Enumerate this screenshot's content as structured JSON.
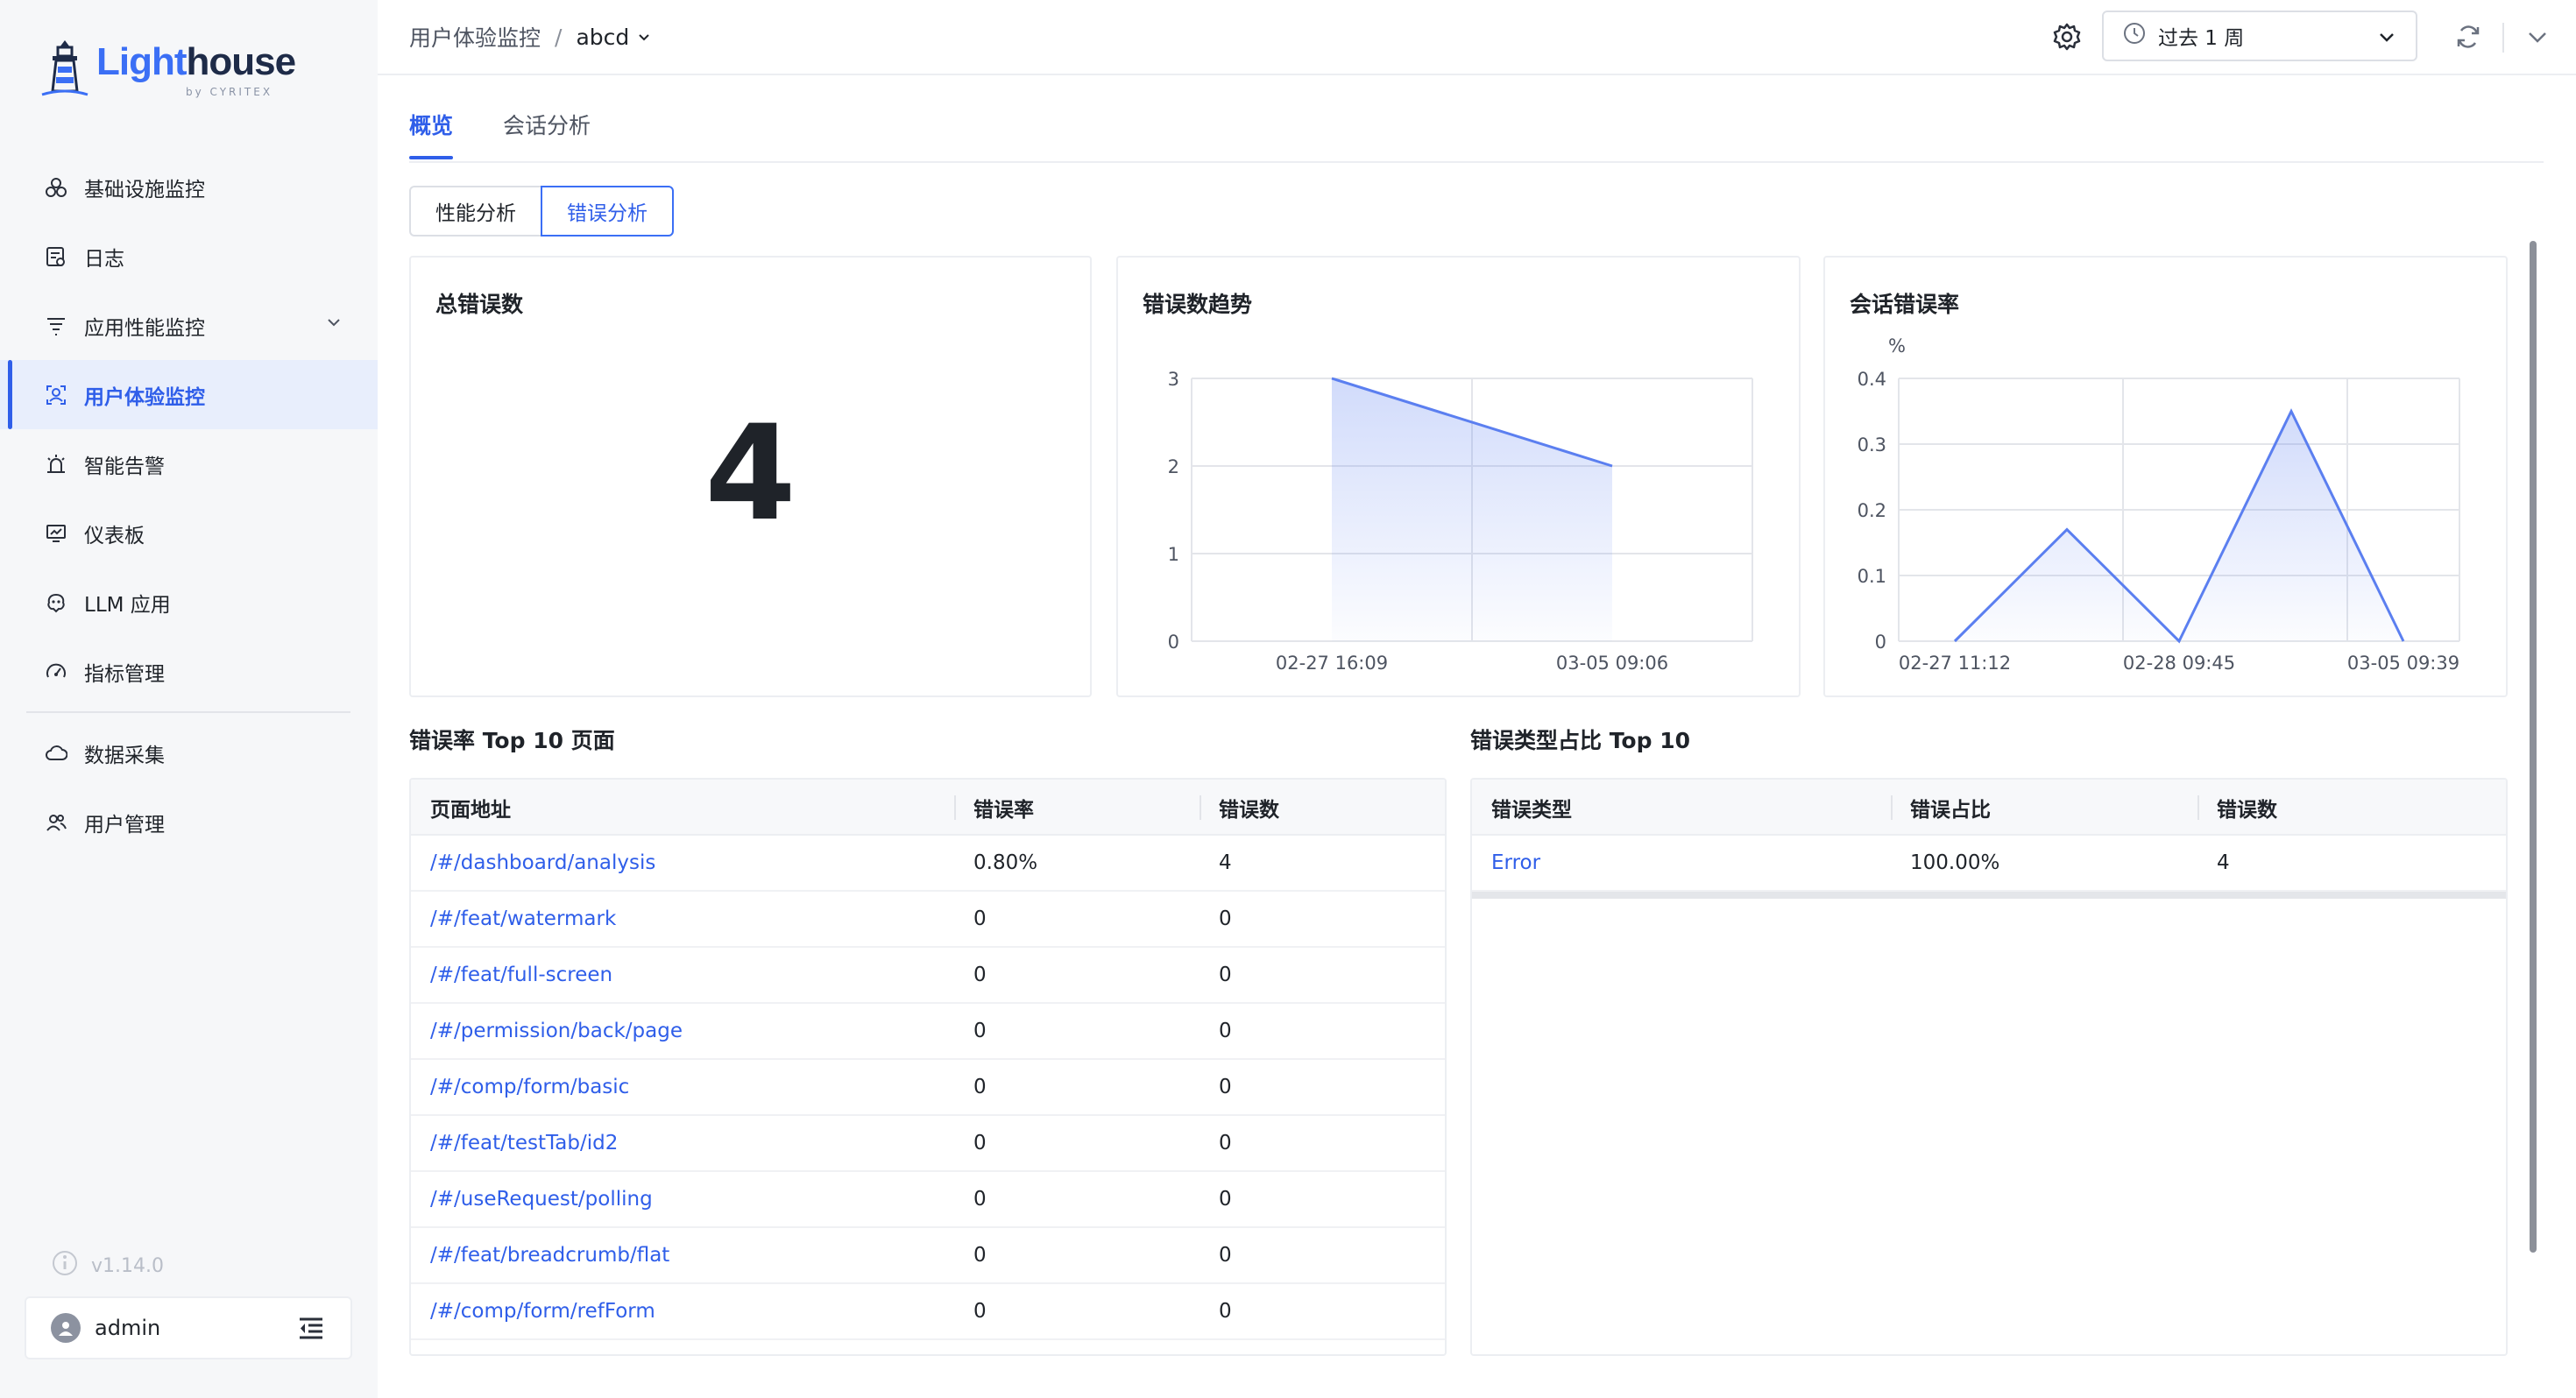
{
  "brand": {
    "name_part1": "Light",
    "name_part2": "house",
    "sub": "by CYRITEX"
  },
  "sidebar": {
    "items": [
      {
        "label": "基础设施监控",
        "icon": "infrastructure-icon"
      },
      {
        "label": "日志",
        "icon": "log-icon"
      },
      {
        "label": "应用性能监控",
        "icon": "apm-icon",
        "expandable": true
      },
      {
        "label": "用户体验监控",
        "icon": "user-experience-icon",
        "active": true
      },
      {
        "label": "智能告警",
        "icon": "alarm-icon"
      },
      {
        "label": "仪表板",
        "icon": "dashboard-icon"
      },
      {
        "label": "LLM 应用",
        "icon": "llm-icon"
      },
      {
        "label": "指标管理",
        "icon": "metrics-icon"
      },
      {
        "label": "数据采集",
        "icon": "data-collection-icon"
      },
      {
        "label": "用户管理",
        "icon": "user-management-icon"
      }
    ],
    "version": "v1.14.0",
    "user": "admin"
  },
  "header": {
    "breadcrumb_root": "用户体验监控",
    "breadcrumb_sep": "/",
    "breadcrumb_current": "abcd",
    "time_range": "过去 1 周"
  },
  "tabs": [
    {
      "label": "概览",
      "active": true
    },
    {
      "label": "会话分析"
    }
  ],
  "segments": [
    {
      "label": "性能分析"
    },
    {
      "label": "错误分析",
      "active": true
    }
  ],
  "total_errors": {
    "title": "总错误数",
    "value": "4"
  },
  "error_trend": {
    "title": "错误数趋势"
  },
  "session_error_rate": {
    "title": "会话错误率",
    "unit": "%"
  },
  "chart_data": [
    {
      "type": "area",
      "title": "错误数趋势",
      "x": [
        "02-27 16:09",
        "03-05 09:06"
      ],
      "values": [
        3,
        2
      ],
      "yticks": [
        0,
        1,
        2,
        3
      ],
      "ylim": [
        0,
        3
      ],
      "grid": true,
      "color": "#5b7ff0"
    },
    {
      "type": "area",
      "title": "会话错误率",
      "ylabel": "%",
      "x": [
        "02-27 11:12",
        "",
        "02-28 09:45",
        "",
        "03-05 09:39"
      ],
      "xticks": [
        "02-27 11:12",
        "02-28 09:45",
        "03-05 09:39"
      ],
      "values": [
        0,
        0.17,
        0,
        0.35,
        0
      ],
      "yticks": [
        0,
        0.1,
        0.2,
        0.3,
        0.4
      ],
      "ylim": [
        0,
        0.4
      ],
      "grid": true,
      "color": "#5b7ff0"
    }
  ],
  "top_pages": {
    "title": "错误率 Top 10 页面",
    "columns": [
      "页面地址",
      "错误率",
      "错误数"
    ],
    "rows": [
      [
        "/#/dashboard/analysis",
        "0.80%",
        "4"
      ],
      [
        "/#/feat/watermark",
        "0",
        "0"
      ],
      [
        "/#/feat/full-screen",
        "0",
        "0"
      ],
      [
        "/#/permission/back/page",
        "0",
        "0"
      ],
      [
        "/#/comp/form/basic",
        "0",
        "0"
      ],
      [
        "/#/feat/testTab/id2",
        "0",
        "0"
      ],
      [
        "/#/useRequest/polling",
        "0",
        "0"
      ],
      [
        "/#/feat/breadcrumb/flat",
        "0",
        "0"
      ],
      [
        "/#/comp/form/refForm",
        "0",
        "0"
      ]
    ]
  },
  "error_types": {
    "title": "错误类型占比 Top 10",
    "columns": [
      "错误类型",
      "错误占比",
      "错误数"
    ],
    "rows": [
      [
        "Error",
        "100.00%",
        "4"
      ]
    ]
  },
  "colors": {
    "accent": "#2f5ee9",
    "line": "#5b7ff0"
  }
}
